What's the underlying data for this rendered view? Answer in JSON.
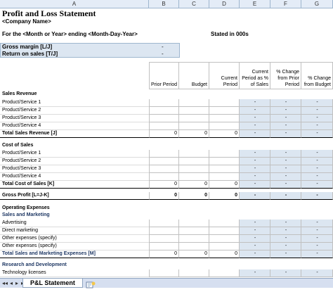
{
  "columns": {
    "a": "A",
    "b": "B",
    "c": "C",
    "d": "D",
    "e": "E",
    "f": "F",
    "g": "G"
  },
  "title": "Profit and Loss Statement",
  "company": "<Company Name>",
  "period_line": "For the <Month or Year> ending <Month-Day-Year>",
  "stated": "Stated in 000s",
  "gross_margin_label": "Gross margin  [L/J]",
  "return_on_sales_label": "Return on sales  [T/J]",
  "dash": "-",
  "headers": {
    "prior": "Prior Period",
    "budget": "Budget",
    "current_l1": "Current",
    "current_l2": "Period",
    "cur_pct_l1": "Current",
    "cur_pct_l2": "Period as %",
    "cur_pct_l3": "of Sales",
    "chg_prior_l1": "% Change",
    "chg_prior_l2": "from Prior",
    "chg_prior_l3": "Period",
    "chg_budget_l1": "% Change",
    "chg_budget_l2": "from Budget"
  },
  "sales_revenue_title": "Sales Revenue",
  "product_1": "Product/Service 1",
  "product_2": "Product/Service 2",
  "product_3": "Product/Service 3",
  "product_4": "Product/Service 4",
  "total_sales_revenue": "Total Sales Revenue  [J]",
  "cost_of_sales_title": "Cost of Sales",
  "total_cost_of_sales": "Total Cost of Sales  [K]",
  "gross_profit": "Gross Profit  [L=J-K]",
  "operating_expenses_title": "Operating Expenses",
  "sales_marketing_title": "Sales and Marketing",
  "advertising": "Advertising",
  "direct_marketing": "Direct marketing",
  "other_expenses_1": "Other expenses (specify)",
  "other_expenses_2": "Other expenses (specify)",
  "total_sales_marketing": "Total Sales and Marketing Expenses  [M]",
  "rd_title": "Research and Development",
  "technology_licenses": "Technology licenses",
  "zero": "0",
  "tab_name": "P&L Statement",
  "nav": {
    "first": "◂◂",
    "prev": "◂",
    "next": "▸",
    "last": "▸▸"
  }
}
